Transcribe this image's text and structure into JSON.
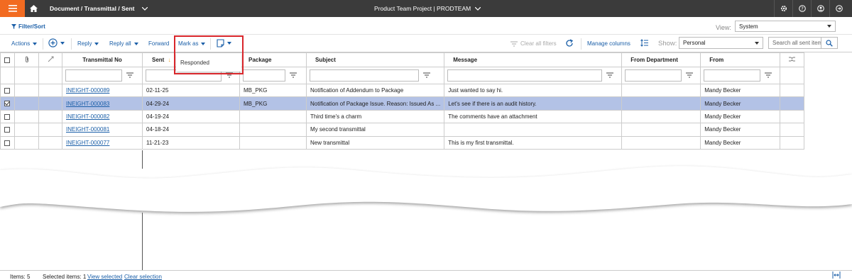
{
  "topbar": {
    "breadcrumb": "Document / Transmittal / Sent",
    "project": "Product Team Project | PRODTEAM"
  },
  "filterbar": {
    "filter_sort": "Filter/Sort",
    "view_label": "View:",
    "view_value": "System"
  },
  "toolbar": {
    "actions": "Actions",
    "reply": "Reply",
    "reply_all": "Reply all",
    "forward": "Forward",
    "mark_as": "Mark as",
    "clear_filters": "Clear all filters",
    "manage_columns": "Manage columns",
    "show_label": "Show:",
    "show_value": "Personal",
    "search_placeholder": "Search all sent items"
  },
  "dropdown": {
    "option": "Responded"
  },
  "table": {
    "headers": [
      "Transmittal No",
      "Sent",
      "Package",
      "Subject",
      "Message",
      "From Department",
      "From"
    ],
    "rows": [
      {
        "no": "INEIGHT-000089",
        "sent": "02-11-25",
        "package": "MB_PKG",
        "subject": "Notification of Addendum to Package",
        "message": "Just wanted to say hi.",
        "dept": "",
        "from": "Mandy Becker",
        "selected": false
      },
      {
        "no": "INEIGHT-000083",
        "sent": "04-29-24",
        "package": "MB_PKG",
        "subject": "Notification of Package Issue. Reason: Issued As ...",
        "message": "Let's see if there is an audit history.",
        "dept": "",
        "from": "Mandy Becker",
        "selected": true
      },
      {
        "no": "INEIGHT-000082",
        "sent": "04-19-24",
        "package": "",
        "subject": "Third time's a charm",
        "message": "The comments have an attachment",
        "dept": "",
        "from": "Mandy Becker",
        "selected": false
      },
      {
        "no": "INEIGHT-000081",
        "sent": "04-18-24",
        "package": "",
        "subject": "My second transmittal",
        "message": "",
        "dept": "",
        "from": "Mandy Becker",
        "selected": false
      },
      {
        "no": "INEIGHT-000077",
        "sent": "11-21-23",
        "package": "",
        "subject": "New transmittal",
        "message": "This is my first transmittal.",
        "dept": "",
        "from": "Mandy Becker",
        "selected": false
      }
    ]
  },
  "status": {
    "items": "Items: 5",
    "selected": "Selected items: 1",
    "view_selected": "View selected",
    "clear_selection": "Clear selection"
  },
  "colors": {
    "accent": "#f26b21",
    "link": "#1b5fa8",
    "selected_row": "#b3c2e6",
    "highlight": "#d9262b"
  }
}
